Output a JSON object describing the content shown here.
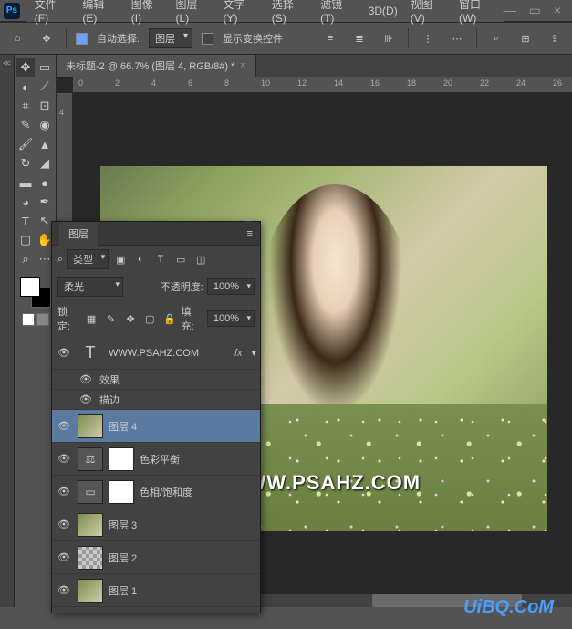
{
  "app": {
    "name": "Ps"
  },
  "menubar": [
    "文件(F)",
    "编辑(E)",
    "图像(I)",
    "图层(L)",
    "文字(Y)",
    "选择(S)",
    "滤镜(T)",
    "3D(D)",
    "视图(V)",
    "窗口(W)"
  ],
  "window_controls": {
    "min": "—",
    "max": "▭",
    "close": "×"
  },
  "options": {
    "auto_select_label": "自动选择:",
    "auto_select_target": "图层",
    "show_transform_label": "显示变换控件"
  },
  "document": {
    "tab_title": "未标题-2 @ 66.7% (图层 4, RGB/8#) *"
  },
  "ruler_h": [
    "0",
    "2",
    "4",
    "6",
    "8",
    "10",
    "12",
    "14",
    "16",
    "18",
    "20",
    "22",
    "24",
    "26"
  ],
  "ruler_v": [
    "4"
  ],
  "watermark1": "WWW.PSAHZ.COM",
  "watermark2": "UiBQ.CoM",
  "layers_panel": {
    "title": "图层",
    "filter_label": "类型",
    "blend_mode": "柔光",
    "opacity_label": "不透明度:",
    "opacity_value": "100%",
    "lock_label": "锁定:",
    "fill_label": "填充:",
    "fill_value": "100%",
    "layers": [
      {
        "type": "text",
        "name": "WWW.PSAHZ.COM",
        "fx": true
      },
      {
        "type": "sub",
        "name": "效果"
      },
      {
        "type": "sub",
        "name": "描边"
      },
      {
        "type": "img",
        "name": "图层 4",
        "active": true
      },
      {
        "type": "adj",
        "icon": "⚖",
        "name": "色彩平衡"
      },
      {
        "type": "adj",
        "icon": "▭",
        "name": "色相/饱和度"
      },
      {
        "type": "img",
        "name": "图层 3"
      },
      {
        "type": "chk",
        "name": "图层 2"
      },
      {
        "type": "img",
        "name": "图层 1"
      }
    ]
  }
}
